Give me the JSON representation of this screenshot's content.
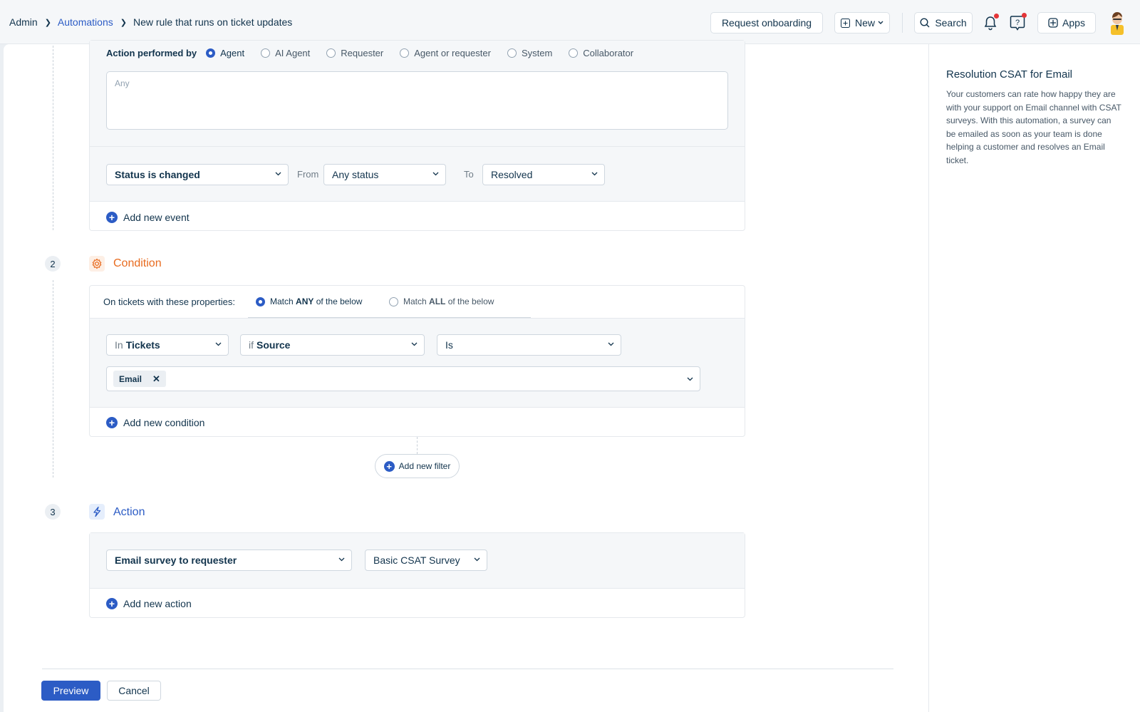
{
  "breadcrumb": {
    "admin": "Admin",
    "automations": "Automations",
    "current": "New rule that runs on ticket updates"
  },
  "topbar": {
    "request_onboarding": "Request onboarding",
    "new": "New",
    "search": "Search",
    "apps": "Apps"
  },
  "event": {
    "performed_by_label": "Action performed by",
    "performed_by_options": [
      "Agent",
      "AI Agent",
      "Requester",
      "Agent or requester",
      "System",
      "Collaborator"
    ],
    "performed_by_selected": "Agent",
    "agent_placeholder": "Any",
    "event_select": "Status is changed",
    "from_label": "From",
    "from_select": "Any status",
    "to_label": "To",
    "to_select": "Resolved",
    "add_event": "Add new event"
  },
  "condition": {
    "step_number": "2",
    "title": "Condition",
    "properties_label": "On tickets with these properties:",
    "match_any_pre": "Match",
    "match_any_bold": "ANY",
    "match_any_post": "of the below",
    "match_all_pre": "Match",
    "match_all_bold": "ALL",
    "match_all_post": "of the below",
    "selected": "ANY",
    "in_prefix": "In",
    "in_value": "Tickets",
    "if_prefix": "if",
    "if_value": "Source",
    "operator": "Is",
    "chip": "Email",
    "add_condition": "Add new condition",
    "add_filter": "Add new filter"
  },
  "action": {
    "step_number": "3",
    "title": "Action",
    "action_select": "Email survey to requester",
    "survey_select": "Basic CSAT Survey",
    "add_action": "Add new action"
  },
  "footer": {
    "preview": "Preview",
    "cancel": "Cancel"
  },
  "side_panel": {
    "title": "Resolution CSAT for Email",
    "description": "Your customers can rate how happy they are with your support on Email channel with CSAT surveys. With this automation, a survey can be emailed as soon as your team is done helping a customer and resolves an Email ticket."
  },
  "colors": {
    "accent": "#2c5cc5",
    "condition": "#e86b1f",
    "action": "#2c5cc5",
    "notification_dot": "#e43538"
  }
}
